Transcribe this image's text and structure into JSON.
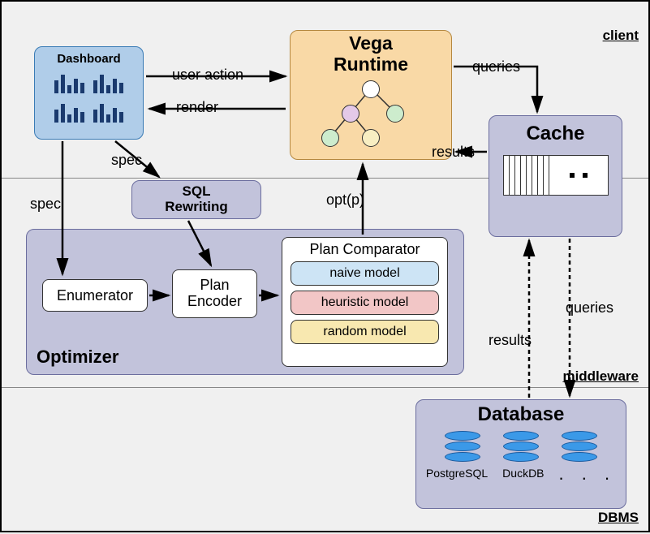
{
  "layers": {
    "client": "client",
    "middleware": "middleware",
    "dbms": "DBMS"
  },
  "dashboard": {
    "title": "Dashboard"
  },
  "vega": {
    "title_line1": "Vega",
    "title_line2": "Runtime"
  },
  "cache": {
    "title": "Cache"
  },
  "sql_rewriting": {
    "title_line1": "SQL",
    "title_line2": "Rewriting"
  },
  "optimizer": {
    "title": "Optimizer",
    "enumerator": "Enumerator",
    "plan_encoder": "Plan Encoder",
    "comparator": {
      "title": "Plan Comparator",
      "models": {
        "naive": "naive model",
        "heuristic": "heuristic model",
        "random": "random model"
      }
    }
  },
  "database": {
    "title": "Database",
    "engines": {
      "postgresql": "PostgreSQL",
      "duckdb": "DuckDB",
      "more": ". . ."
    }
  },
  "edges": {
    "user_action": "user action",
    "render": "render",
    "spec1": "spec",
    "spec2": "spec",
    "opt_p": "opt(p)",
    "queries1": "queries",
    "results1": "results",
    "queries2": "queries",
    "results2": "results"
  }
}
